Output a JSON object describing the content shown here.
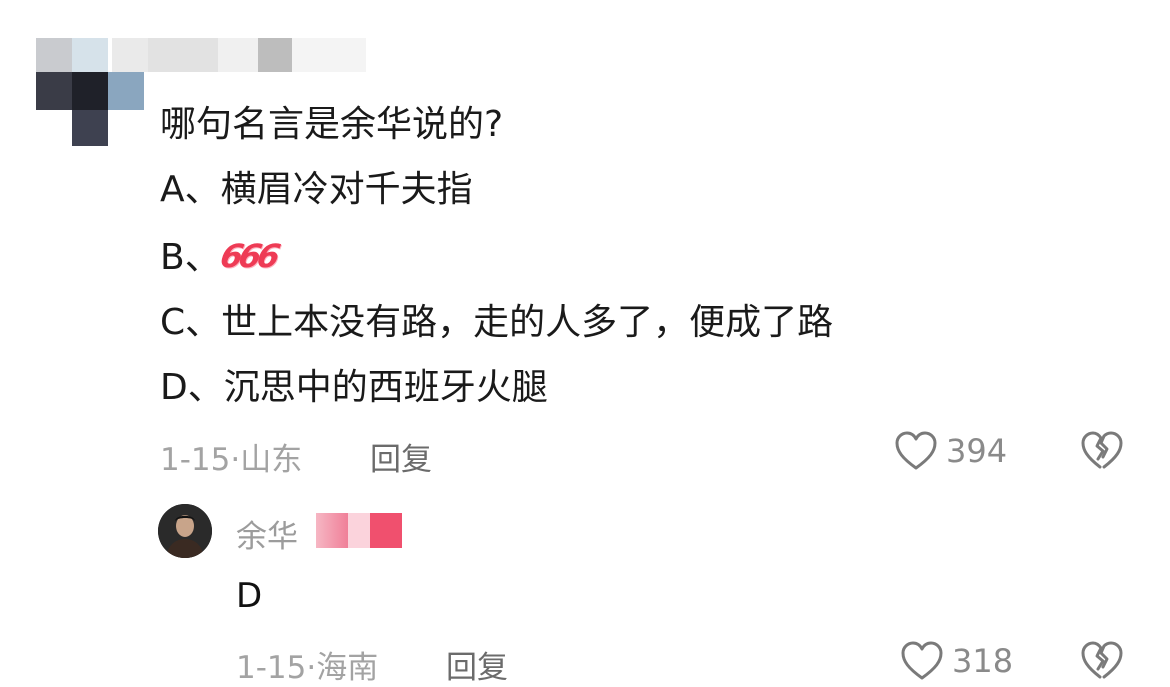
{
  "comment1": {
    "question": "哪句名言是余华说的?",
    "options": [
      {
        "prefix": "A、",
        "text": "横眉冷对千夫指"
      },
      {
        "prefix": "B、",
        "text": "",
        "sticker": "666"
      },
      {
        "prefix": "C、",
        "text": "世上本没有路，走的人多了，便成了路"
      },
      {
        "prefix": "D、",
        "text": "沉思中的西班牙火腿"
      }
    ],
    "date": "1-15",
    "separator": "·",
    "location": "山东",
    "reply_label": "回复",
    "likes": "394"
  },
  "comment2": {
    "username": "余华",
    "text": "D",
    "date": "1-15",
    "separator": "·",
    "location": "海南",
    "reply_label": "回复",
    "likes": "318"
  },
  "icons": {
    "like": "heart-icon",
    "dislike": "broken-heart-icon"
  },
  "colors": {
    "meta_gray": "#a3a3a3",
    "badge_pink": "#f0506e"
  }
}
